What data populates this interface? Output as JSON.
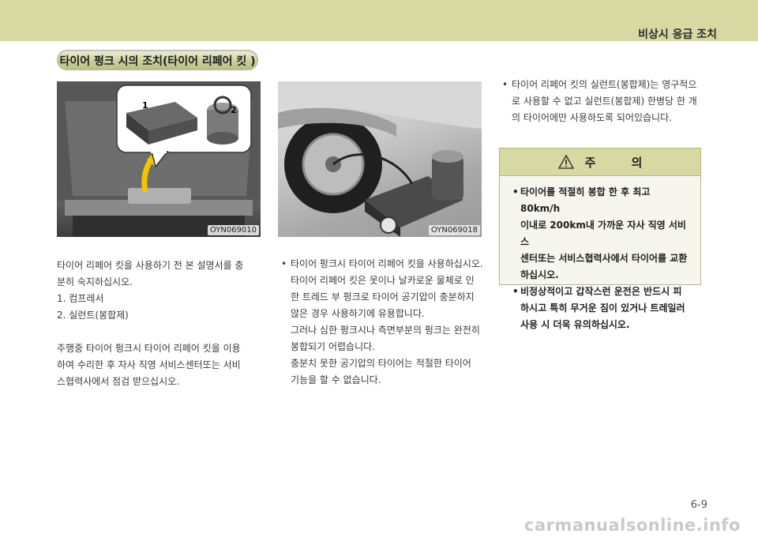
{
  "header": {
    "section_title": "비상시 응급 조치"
  },
  "section": {
    "heading": "타이어 펑크 시의 조치(타이어 리페어 킷 )"
  },
  "figures": [
    {
      "code": "OYN069010",
      "callouts": [
        "1",
        "2"
      ]
    },
    {
      "code": "OYN069018"
    }
  ],
  "col1": {
    "intro": [
      "타이어 리페어 킷을 사용하기 전 본 설명서를 충",
      "분히 숙지하십시오."
    ],
    "items": [
      "1.  컴프레서",
      "2.  실런트(봉합제)"
    ],
    "para2": [
      "주행중 타이어 펑크시 타이어 리페어 킷을 이용",
      "하여 수리한 후 자사 직영 서비스센터또는 서비",
      "스협력사에서 점검 받으십시오."
    ]
  },
  "col2": {
    "bullet": [
      "타이어 펑크시 타이어 리페어 킷을 사용하십시오.",
      "타이어 리페어 킷은 못이나 날카로운 물체로 인",
      "한 트레드 부 펑크로 타이어 공기압이 충분하지",
      "않은 경우 사용하기에 유용합니다.",
      "그러나 심한 펑크시나 측면부분의 펑크는 완전히",
      "봉합되기 어렵습니다.",
      "충분치 못한 공기압의 타이어는 적절한 타이어",
      "기능을 할 수 없습니다."
    ]
  },
  "col3": {
    "bullet": [
      "타이어 리페어 킷의 실런트(봉합제)는 영구적으",
      "로 사용할 수 없고 실런트(봉합제) 한병당 한 개",
      "의 타이어에만 사용하도록 되어있습니다."
    ],
    "caution": {
      "title": "주 의",
      "icon": "warning-triangle-icon",
      "b1": [
        "타이어를 적절히 봉합 한 후 최고 80km/h",
        "이내로 200km내 가까운 자사 직영 서비스",
        "센터또는 서비스협력사에서 타이어를 교환",
        "하십시오."
      ],
      "b2": [
        "비정상적이고 갑작스런 운전은 반드시 피",
        "하시고 특히 무거운 짐이 있거나 트레일러",
        "사용 시 더욱 유의하십시오."
      ]
    }
  },
  "footer": {
    "page_number": "6-9",
    "watermark": "carmanualsonline.info"
  },
  "colors": {
    "header_band": "#d8d8a3",
    "caution_border": "#b5b58a"
  }
}
